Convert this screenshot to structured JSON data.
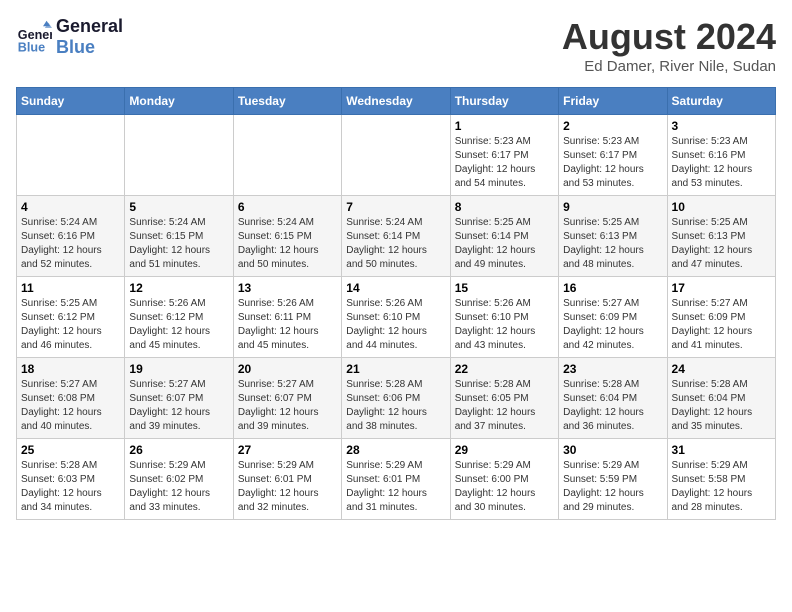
{
  "header": {
    "logo_line1": "General",
    "logo_line2": "Blue",
    "main_title": "August 2024",
    "subtitle": "Ed Damer, River Nile, Sudan"
  },
  "days_of_week": [
    "Sunday",
    "Monday",
    "Tuesday",
    "Wednesday",
    "Thursday",
    "Friday",
    "Saturday"
  ],
  "weeks": [
    [
      {
        "day": "",
        "info": ""
      },
      {
        "day": "",
        "info": ""
      },
      {
        "day": "",
        "info": ""
      },
      {
        "day": "",
        "info": ""
      },
      {
        "day": "1",
        "info": "Sunrise: 5:23 AM\nSunset: 6:17 PM\nDaylight: 12 hours\nand 54 minutes."
      },
      {
        "day": "2",
        "info": "Sunrise: 5:23 AM\nSunset: 6:17 PM\nDaylight: 12 hours\nand 53 minutes."
      },
      {
        "day": "3",
        "info": "Sunrise: 5:23 AM\nSunset: 6:16 PM\nDaylight: 12 hours\nand 53 minutes."
      }
    ],
    [
      {
        "day": "4",
        "info": "Sunrise: 5:24 AM\nSunset: 6:16 PM\nDaylight: 12 hours\nand 52 minutes."
      },
      {
        "day": "5",
        "info": "Sunrise: 5:24 AM\nSunset: 6:15 PM\nDaylight: 12 hours\nand 51 minutes."
      },
      {
        "day": "6",
        "info": "Sunrise: 5:24 AM\nSunset: 6:15 PM\nDaylight: 12 hours\nand 50 minutes."
      },
      {
        "day": "7",
        "info": "Sunrise: 5:24 AM\nSunset: 6:14 PM\nDaylight: 12 hours\nand 50 minutes."
      },
      {
        "day": "8",
        "info": "Sunrise: 5:25 AM\nSunset: 6:14 PM\nDaylight: 12 hours\nand 49 minutes."
      },
      {
        "day": "9",
        "info": "Sunrise: 5:25 AM\nSunset: 6:13 PM\nDaylight: 12 hours\nand 48 minutes."
      },
      {
        "day": "10",
        "info": "Sunrise: 5:25 AM\nSunset: 6:13 PM\nDaylight: 12 hours\nand 47 minutes."
      }
    ],
    [
      {
        "day": "11",
        "info": "Sunrise: 5:25 AM\nSunset: 6:12 PM\nDaylight: 12 hours\nand 46 minutes."
      },
      {
        "day": "12",
        "info": "Sunrise: 5:26 AM\nSunset: 6:12 PM\nDaylight: 12 hours\nand 45 minutes."
      },
      {
        "day": "13",
        "info": "Sunrise: 5:26 AM\nSunset: 6:11 PM\nDaylight: 12 hours\nand 45 minutes."
      },
      {
        "day": "14",
        "info": "Sunrise: 5:26 AM\nSunset: 6:10 PM\nDaylight: 12 hours\nand 44 minutes."
      },
      {
        "day": "15",
        "info": "Sunrise: 5:26 AM\nSunset: 6:10 PM\nDaylight: 12 hours\nand 43 minutes."
      },
      {
        "day": "16",
        "info": "Sunrise: 5:27 AM\nSunset: 6:09 PM\nDaylight: 12 hours\nand 42 minutes."
      },
      {
        "day": "17",
        "info": "Sunrise: 5:27 AM\nSunset: 6:09 PM\nDaylight: 12 hours\nand 41 minutes."
      }
    ],
    [
      {
        "day": "18",
        "info": "Sunrise: 5:27 AM\nSunset: 6:08 PM\nDaylight: 12 hours\nand 40 minutes."
      },
      {
        "day": "19",
        "info": "Sunrise: 5:27 AM\nSunset: 6:07 PM\nDaylight: 12 hours\nand 39 minutes."
      },
      {
        "day": "20",
        "info": "Sunrise: 5:27 AM\nSunset: 6:07 PM\nDaylight: 12 hours\nand 39 minutes."
      },
      {
        "day": "21",
        "info": "Sunrise: 5:28 AM\nSunset: 6:06 PM\nDaylight: 12 hours\nand 38 minutes."
      },
      {
        "day": "22",
        "info": "Sunrise: 5:28 AM\nSunset: 6:05 PM\nDaylight: 12 hours\nand 37 minutes."
      },
      {
        "day": "23",
        "info": "Sunrise: 5:28 AM\nSunset: 6:04 PM\nDaylight: 12 hours\nand 36 minutes."
      },
      {
        "day": "24",
        "info": "Sunrise: 5:28 AM\nSunset: 6:04 PM\nDaylight: 12 hours\nand 35 minutes."
      }
    ],
    [
      {
        "day": "25",
        "info": "Sunrise: 5:28 AM\nSunset: 6:03 PM\nDaylight: 12 hours\nand 34 minutes."
      },
      {
        "day": "26",
        "info": "Sunrise: 5:29 AM\nSunset: 6:02 PM\nDaylight: 12 hours\nand 33 minutes."
      },
      {
        "day": "27",
        "info": "Sunrise: 5:29 AM\nSunset: 6:01 PM\nDaylight: 12 hours\nand 32 minutes."
      },
      {
        "day": "28",
        "info": "Sunrise: 5:29 AM\nSunset: 6:01 PM\nDaylight: 12 hours\nand 31 minutes."
      },
      {
        "day": "29",
        "info": "Sunrise: 5:29 AM\nSunset: 6:00 PM\nDaylight: 12 hours\nand 30 minutes."
      },
      {
        "day": "30",
        "info": "Sunrise: 5:29 AM\nSunset: 5:59 PM\nDaylight: 12 hours\nand 29 minutes."
      },
      {
        "day": "31",
        "info": "Sunrise: 5:29 AM\nSunset: 5:58 PM\nDaylight: 12 hours\nand 28 minutes."
      }
    ]
  ]
}
